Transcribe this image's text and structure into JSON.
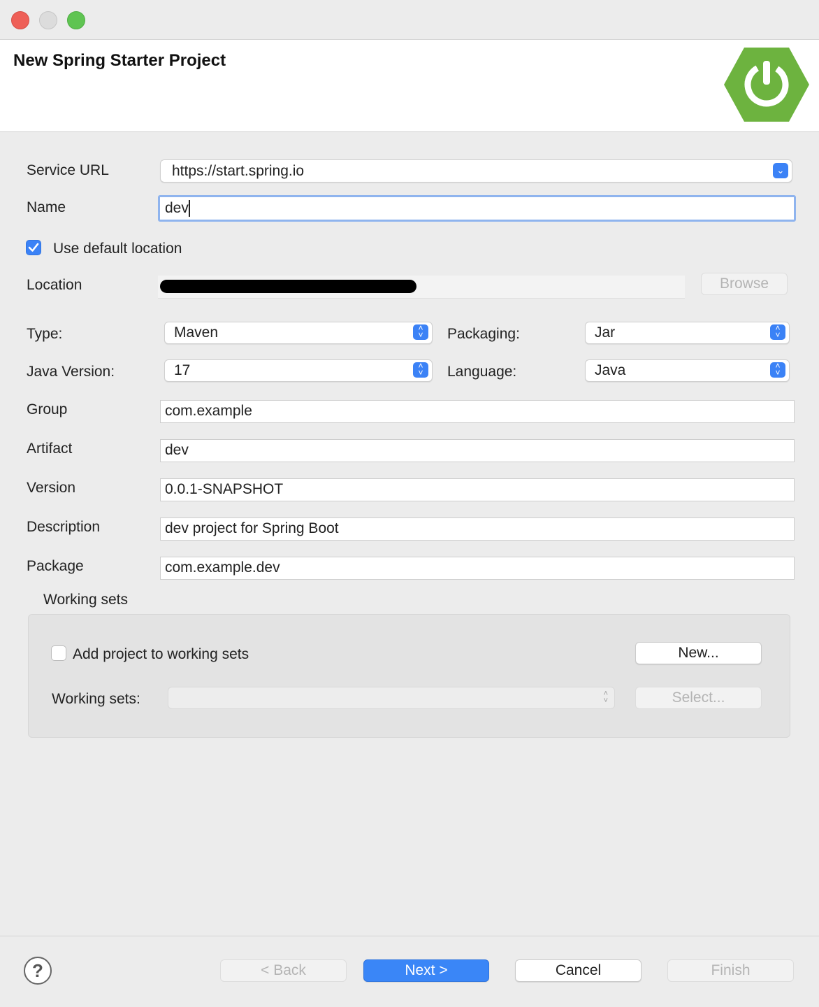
{
  "window": {
    "title": "New Spring Starter Project",
    "logo_icon": "spring-power-icon",
    "accent": "#6db33f"
  },
  "form": {
    "service_url_label": "Service URL",
    "service_url_value": "https://start.spring.io",
    "name_label": "Name",
    "name_value": "dev",
    "use_default_location_label": "Use default location",
    "use_default_location_checked": true,
    "location_label": "Location",
    "location_value": "",
    "browse_label": "Browse",
    "type_label": "Type:",
    "type_value": "Maven",
    "packaging_label": "Packaging:",
    "packaging_value": "Jar",
    "java_version_label": "Java Version:",
    "java_version_value": "17",
    "language_label": "Language:",
    "language_value": "Java",
    "group_label": "Group",
    "group_value": "com.example",
    "artifact_label": "Artifact",
    "artifact_value": "dev",
    "version_label": "Version",
    "version_value": "0.0.1-SNAPSHOT",
    "description_label": "Description",
    "description_value": "dev project for Spring Boot",
    "package_label": "Package",
    "package_value": "com.example.dev"
  },
  "working_sets": {
    "title": "Working sets",
    "add_label": "Add project to working sets",
    "add_checked": false,
    "new_label": "New...",
    "sets_label": "Working sets:",
    "sets_value": "",
    "select_label": "Select..."
  },
  "footer": {
    "help_glyph": "?",
    "back_label": "< Back",
    "next_label": "Next >",
    "cancel_label": "Cancel",
    "finish_label": "Finish"
  }
}
